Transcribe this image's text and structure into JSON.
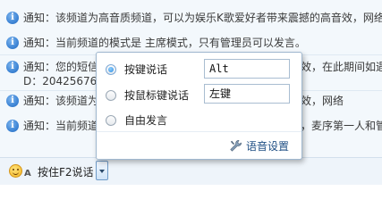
{
  "chat": {
    "messages": [
      {
        "text": "通知：该频道为高音质频道，可以为娱乐K歌爱好者带来震撼的高音效，网络"
      },
      {
        "text": "通知：当前频道的模式是 主席模式，只有管理员可以发言。"
      },
      {
        "text": "通知：您的短信",
        "text_right": "效，在此期间如遇",
        "line2": "D：20425676进"
      },
      {
        "text": "通知：该频道为",
        "text_right": "效，网络"
      },
      {
        "text": "通知：当前频道",
        "text_right": "，麦序第一人和管"
      }
    ]
  },
  "voice_popup": {
    "options": [
      {
        "label": "按键说话",
        "selected": true,
        "key": "Alt"
      },
      {
        "label": "按鼠标键说话",
        "selected": false,
        "key": "左键"
      },
      {
        "label": "自由发言",
        "selected": false
      }
    ],
    "settings_label": "语音设置"
  },
  "toolbar": {
    "font_letter": "A",
    "push_to_talk_label": "按住F2说话"
  }
}
